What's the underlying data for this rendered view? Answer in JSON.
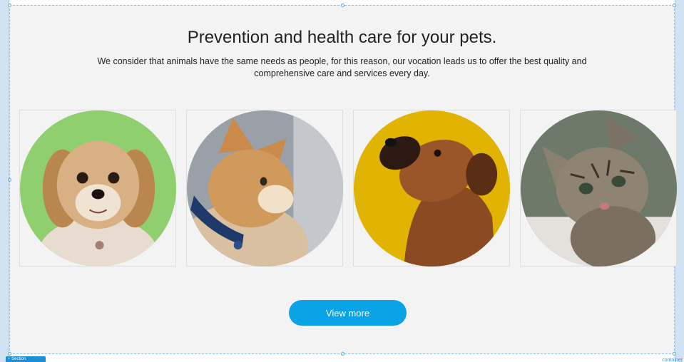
{
  "section": {
    "title": "Prevention and health care for your pets.",
    "description": "We consider that animals have the same needs as people, for this reason, our vocation leads us to offer the best quality and comprehensive care and services every day.",
    "button_label": "View more"
  },
  "gallery": [
    {
      "subject": "dog-portrait",
      "background": "#8fcf6e"
    },
    {
      "subject": "cat-profile",
      "background": "#9aa0a8"
    },
    {
      "subject": "boxer-dog",
      "background": "#e0b400"
    },
    {
      "subject": "tabby-kitten",
      "background": "#6d7a6a"
    }
  ],
  "editor": {
    "left_tag": "+ Section",
    "right_tag": "container"
  },
  "colors": {
    "accent": "#0aa3e6",
    "section_bg": "#f3f3f3",
    "editor_rail": "#cfe3f2"
  }
}
